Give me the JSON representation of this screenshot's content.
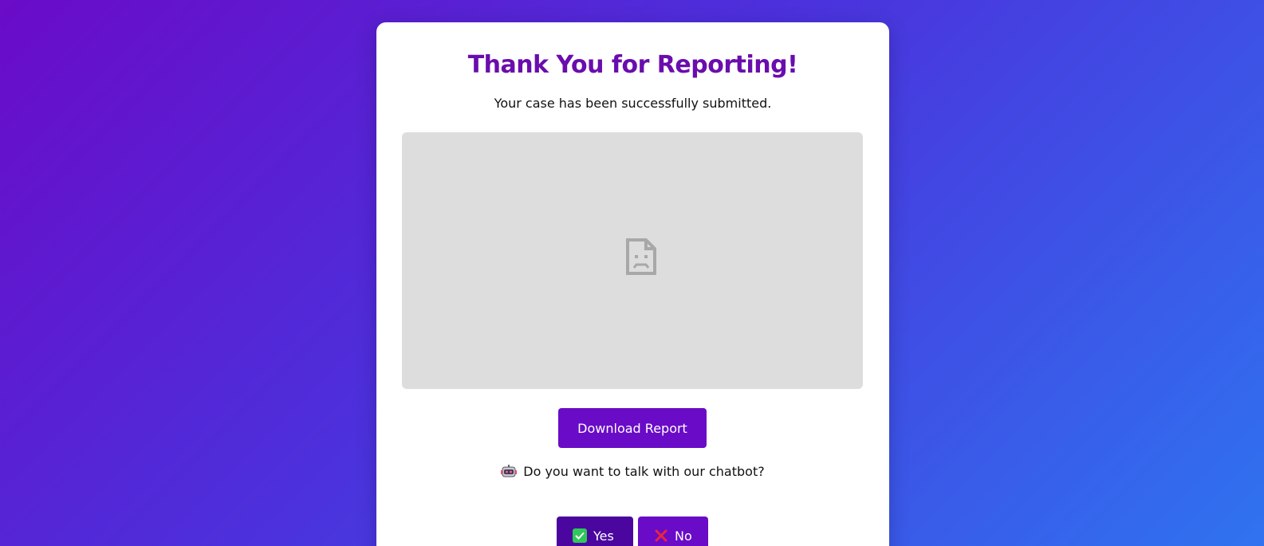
{
  "card": {
    "title": "Thank You for Reporting!",
    "subtitle": "Your case has been successfully submitted."
  },
  "preview": {
    "icon": "broken-image-icon"
  },
  "actions": {
    "download_label": "Download Report"
  },
  "chatbot": {
    "prompt": "Do you want to talk with our chatbot?",
    "icon": "robot-icon",
    "yes_label": "Yes",
    "yes_icon": "check-icon",
    "no_label": "No",
    "no_icon": "cross-icon"
  },
  "colors": {
    "accent": "#6a0bc8",
    "accent_dark": "#4a069e",
    "title": "#6a0dad",
    "preview_bg": "#dddddd",
    "check": "#2fc85a",
    "cross": "#e8263d"
  }
}
